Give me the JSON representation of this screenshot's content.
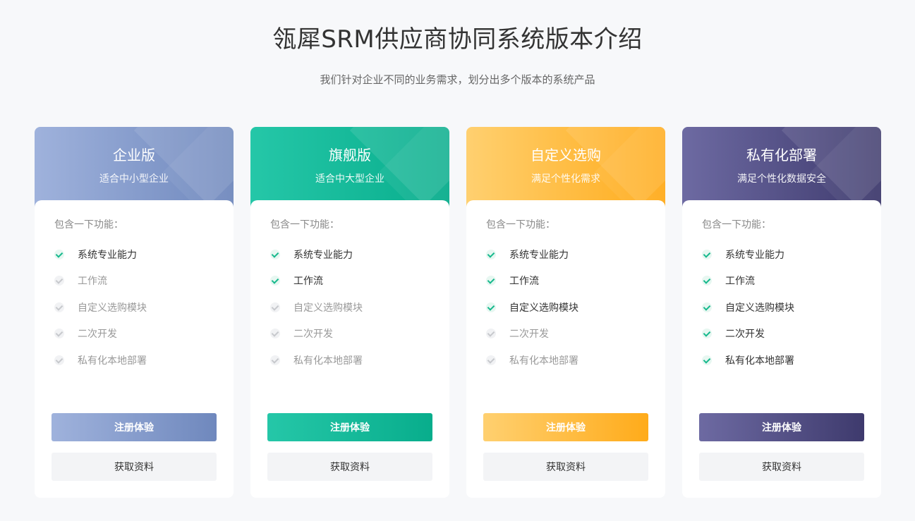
{
  "header": {
    "title": "瓴犀SRM供应商协同系统版本介绍",
    "subtitle": "我们针对企业不同的业务需求，划分出多个版本的系统产品"
  },
  "cards": [
    {
      "name": "企业版",
      "desc": "适合中小型企业",
      "features_title": "包含一下功能：",
      "features": [
        {
          "label": "系统专业能力",
          "enabled": true
        },
        {
          "label": "工作流",
          "enabled": false
        },
        {
          "label": "自定义选购模块",
          "enabled": false
        },
        {
          "label": "二次开发",
          "enabled": false
        },
        {
          "label": "私有化本地部署",
          "enabled": false
        }
      ],
      "primary_label": "注册体验",
      "secondary_label": "获取资料",
      "colors": [
        "#9fb2dc",
        "#6f88bd"
      ]
    },
    {
      "name": "旗舰版",
      "desc": "适合中大型企业",
      "features_title": "包含一下功能：",
      "features": [
        {
          "label": "系统专业能力",
          "enabled": true
        },
        {
          "label": "工作流",
          "enabled": true
        },
        {
          "label": "自定义选购模块",
          "enabled": false
        },
        {
          "label": "二次开发",
          "enabled": false
        },
        {
          "label": "私有化本地部署",
          "enabled": false
        }
      ],
      "primary_label": "注册体验",
      "secondary_label": "获取资料",
      "colors": [
        "#25c7a8",
        "#08ad8c"
      ]
    },
    {
      "name": "自定义选购",
      "desc": "满足个性化需求",
      "features_title": "包含一下功能：",
      "features": [
        {
          "label": "系统专业能力",
          "enabled": true
        },
        {
          "label": "工作流",
          "enabled": true
        },
        {
          "label": "自定义选购模块",
          "enabled": true
        },
        {
          "label": "二次开发",
          "enabled": false
        },
        {
          "label": "私有化本地部署",
          "enabled": false
        }
      ],
      "primary_label": "注册体验",
      "secondary_label": "获取资料",
      "colors": [
        "#ffd070",
        "#ffab1a"
      ]
    },
    {
      "name": "私有化部署",
      "desc": "满足个性化数据安全",
      "features_title": "包含一下功能：",
      "features": [
        {
          "label": "系统专业能力",
          "enabled": true
        },
        {
          "label": "工作流",
          "enabled": true
        },
        {
          "label": "自定义选购模块",
          "enabled": true
        },
        {
          "label": "二次开发",
          "enabled": true
        },
        {
          "label": "私有化本地部署",
          "enabled": true
        }
      ],
      "primary_label": "注册体验",
      "secondary_label": "获取资料",
      "colors": [
        "#6d6aa2",
        "#3e3a6d"
      ]
    }
  ],
  "check_color": "#17b98d"
}
